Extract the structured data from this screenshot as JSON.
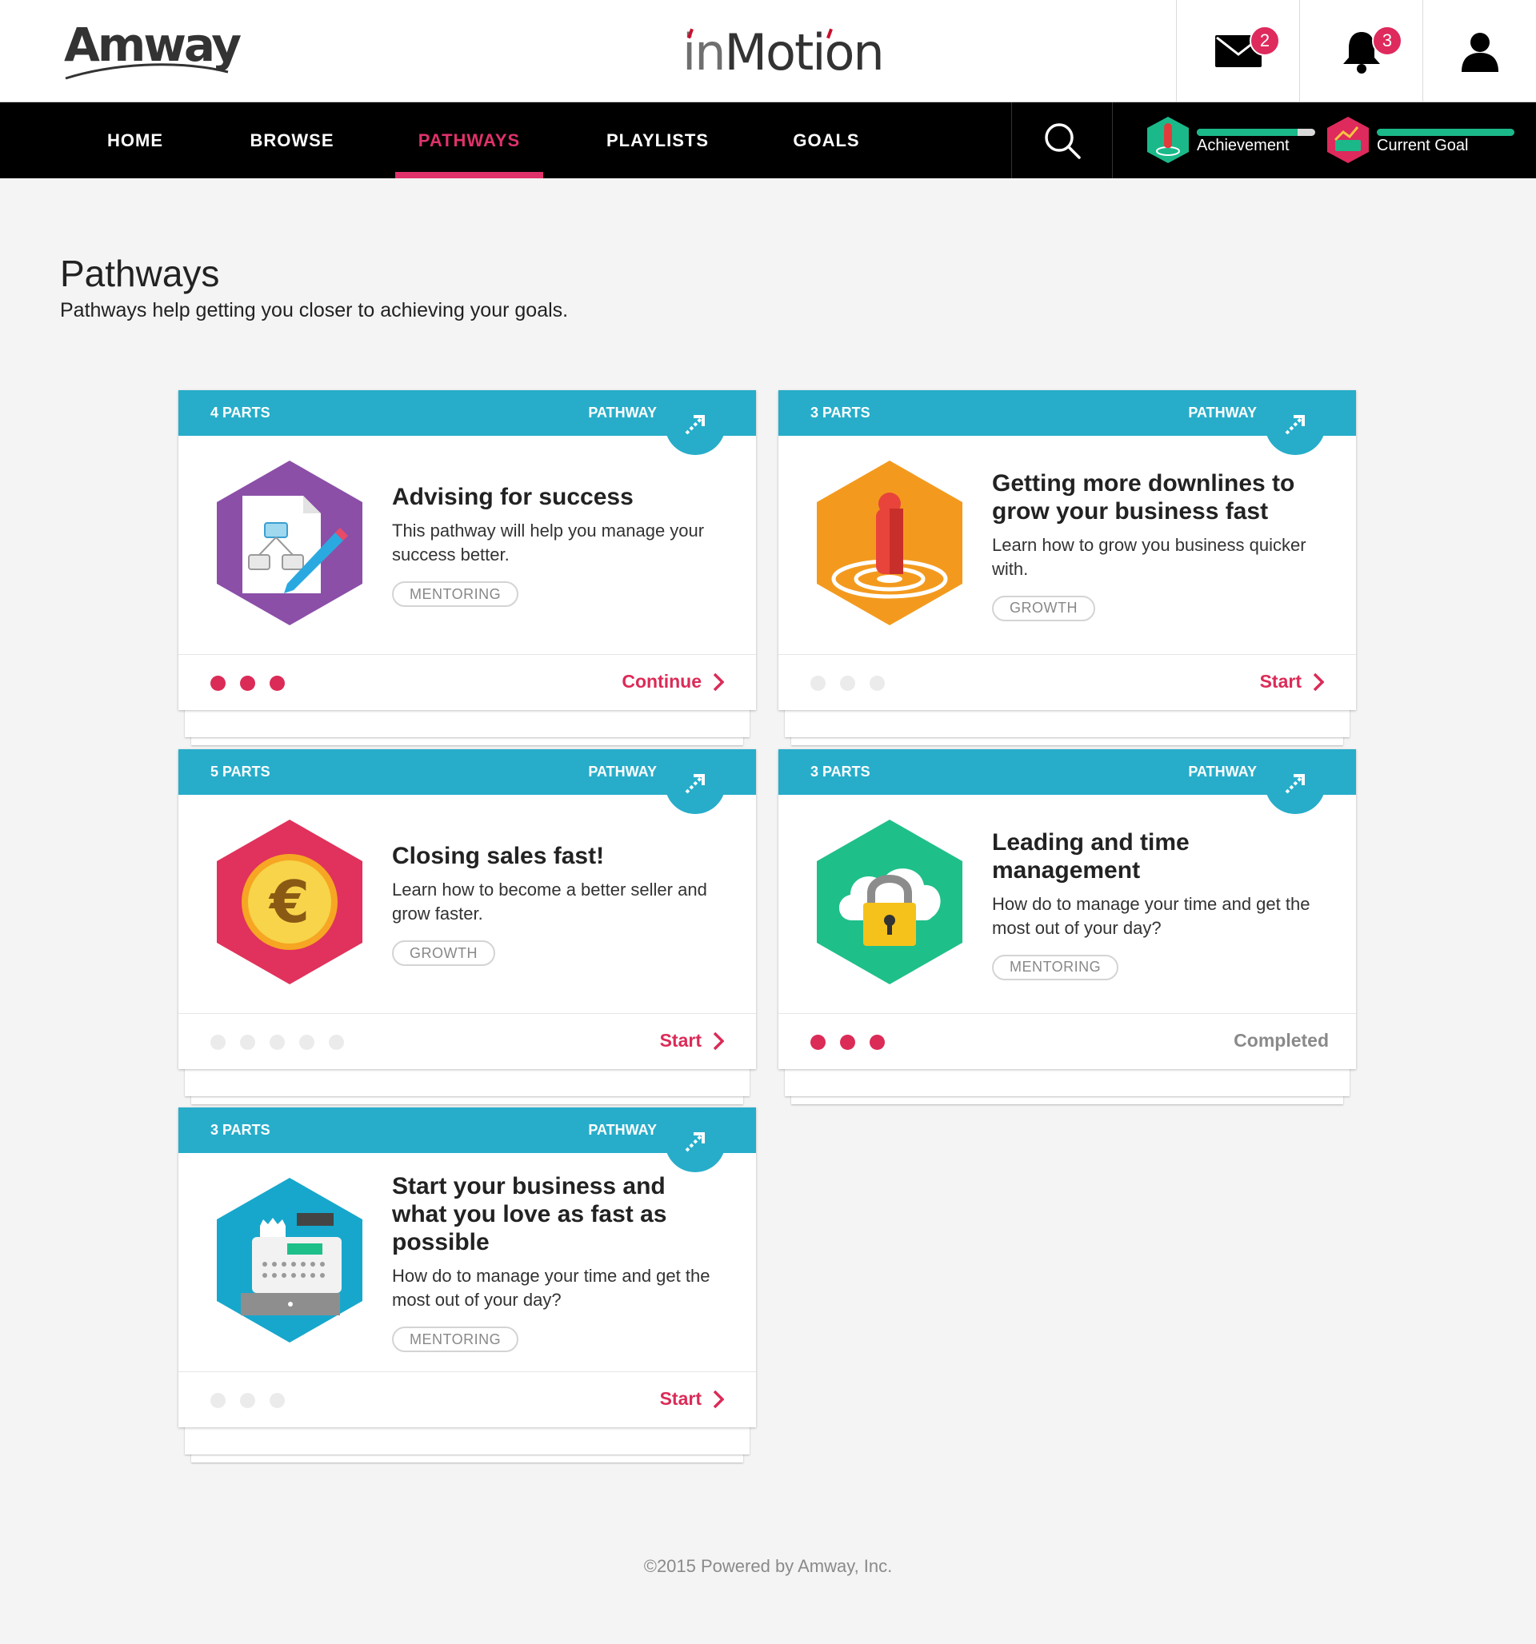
{
  "header": {
    "brand_logo": "Amway",
    "app_logo_in": "in",
    "app_logo_motion": "Motion",
    "mail_badge": "2",
    "notifications_badge": "3",
    "icons": {
      "mail": "envelope-icon",
      "notifications": "bell-icon",
      "profile": "user-icon"
    }
  },
  "nav": {
    "items": [
      {
        "label": "HOME"
      },
      {
        "label": "BROWSE"
      },
      {
        "label": "PATHWAYS"
      },
      {
        "label": "PLAYLISTS"
      },
      {
        "label": "GOALS"
      }
    ],
    "active": "PATHWAYS",
    "search_icon": "search-icon",
    "achievement": {
      "label": "Achievement",
      "progress": 0.85,
      "color": "#1bb98a"
    },
    "current_goal": {
      "label": "Current Goal",
      "progress": 1.0,
      "color": "#de2a5c"
    }
  },
  "page": {
    "title": "Pathways",
    "subtitle": "Pathways help getting you closer to achieving your goals."
  },
  "cards": [
    {
      "parts": "4 PARTS",
      "type": "PATHWAY",
      "title": "Advising for success",
      "description": "This pathway will help you manage your success better.",
      "tag": "MENTORING",
      "icon": "document-flowchart-pencil-icon",
      "icon_color": "#8b4fa8",
      "dots_total": 3,
      "dots_done": 3,
      "action": "Continue"
    },
    {
      "parts": "3 PARTS",
      "type": "PATHWAY",
      "title": "Getting more downlines to grow your business fast",
      "description": "Learn how to grow you business quicker with.",
      "tag": "GROWTH",
      "icon": "person-on-target-icon",
      "icon_color": "#f39a1e",
      "dots_total": 3,
      "dots_done": 0,
      "action": "Start"
    },
    {
      "parts": "5 PARTS",
      "type": "PATHWAY",
      "title": "Closing sales fast!",
      "description": "Learn how to become a better seller and grow faster.",
      "tag": "GROWTH",
      "icon": "euro-coin-icon",
      "icon_color": "#e0325c",
      "dots_total": 5,
      "dots_done": 0,
      "action": "Start"
    },
    {
      "parts": "3 PARTS",
      "type": "PATHWAY",
      "title": "Leading and time management",
      "description": "How do to manage your time and get the most out of your day?",
      "tag": "MENTORING",
      "icon": "cloud-padlock-icon",
      "icon_color": "#1fbf8a",
      "dots_total": 3,
      "dots_done": 3,
      "action": "Completed"
    },
    {
      "parts": "3 PARTS",
      "type": "PATHWAY",
      "title": "Start your business and what you love as fast as possible",
      "description": "How do to manage your time and get the most out of your day?",
      "tag": "MENTORING",
      "icon": "cash-register-icon",
      "icon_color": "#17a7cc",
      "dots_total": 3,
      "dots_done": 0,
      "action": "Start"
    }
  ],
  "footer": {
    "text": "©2015 Powered by Amway, Inc."
  }
}
